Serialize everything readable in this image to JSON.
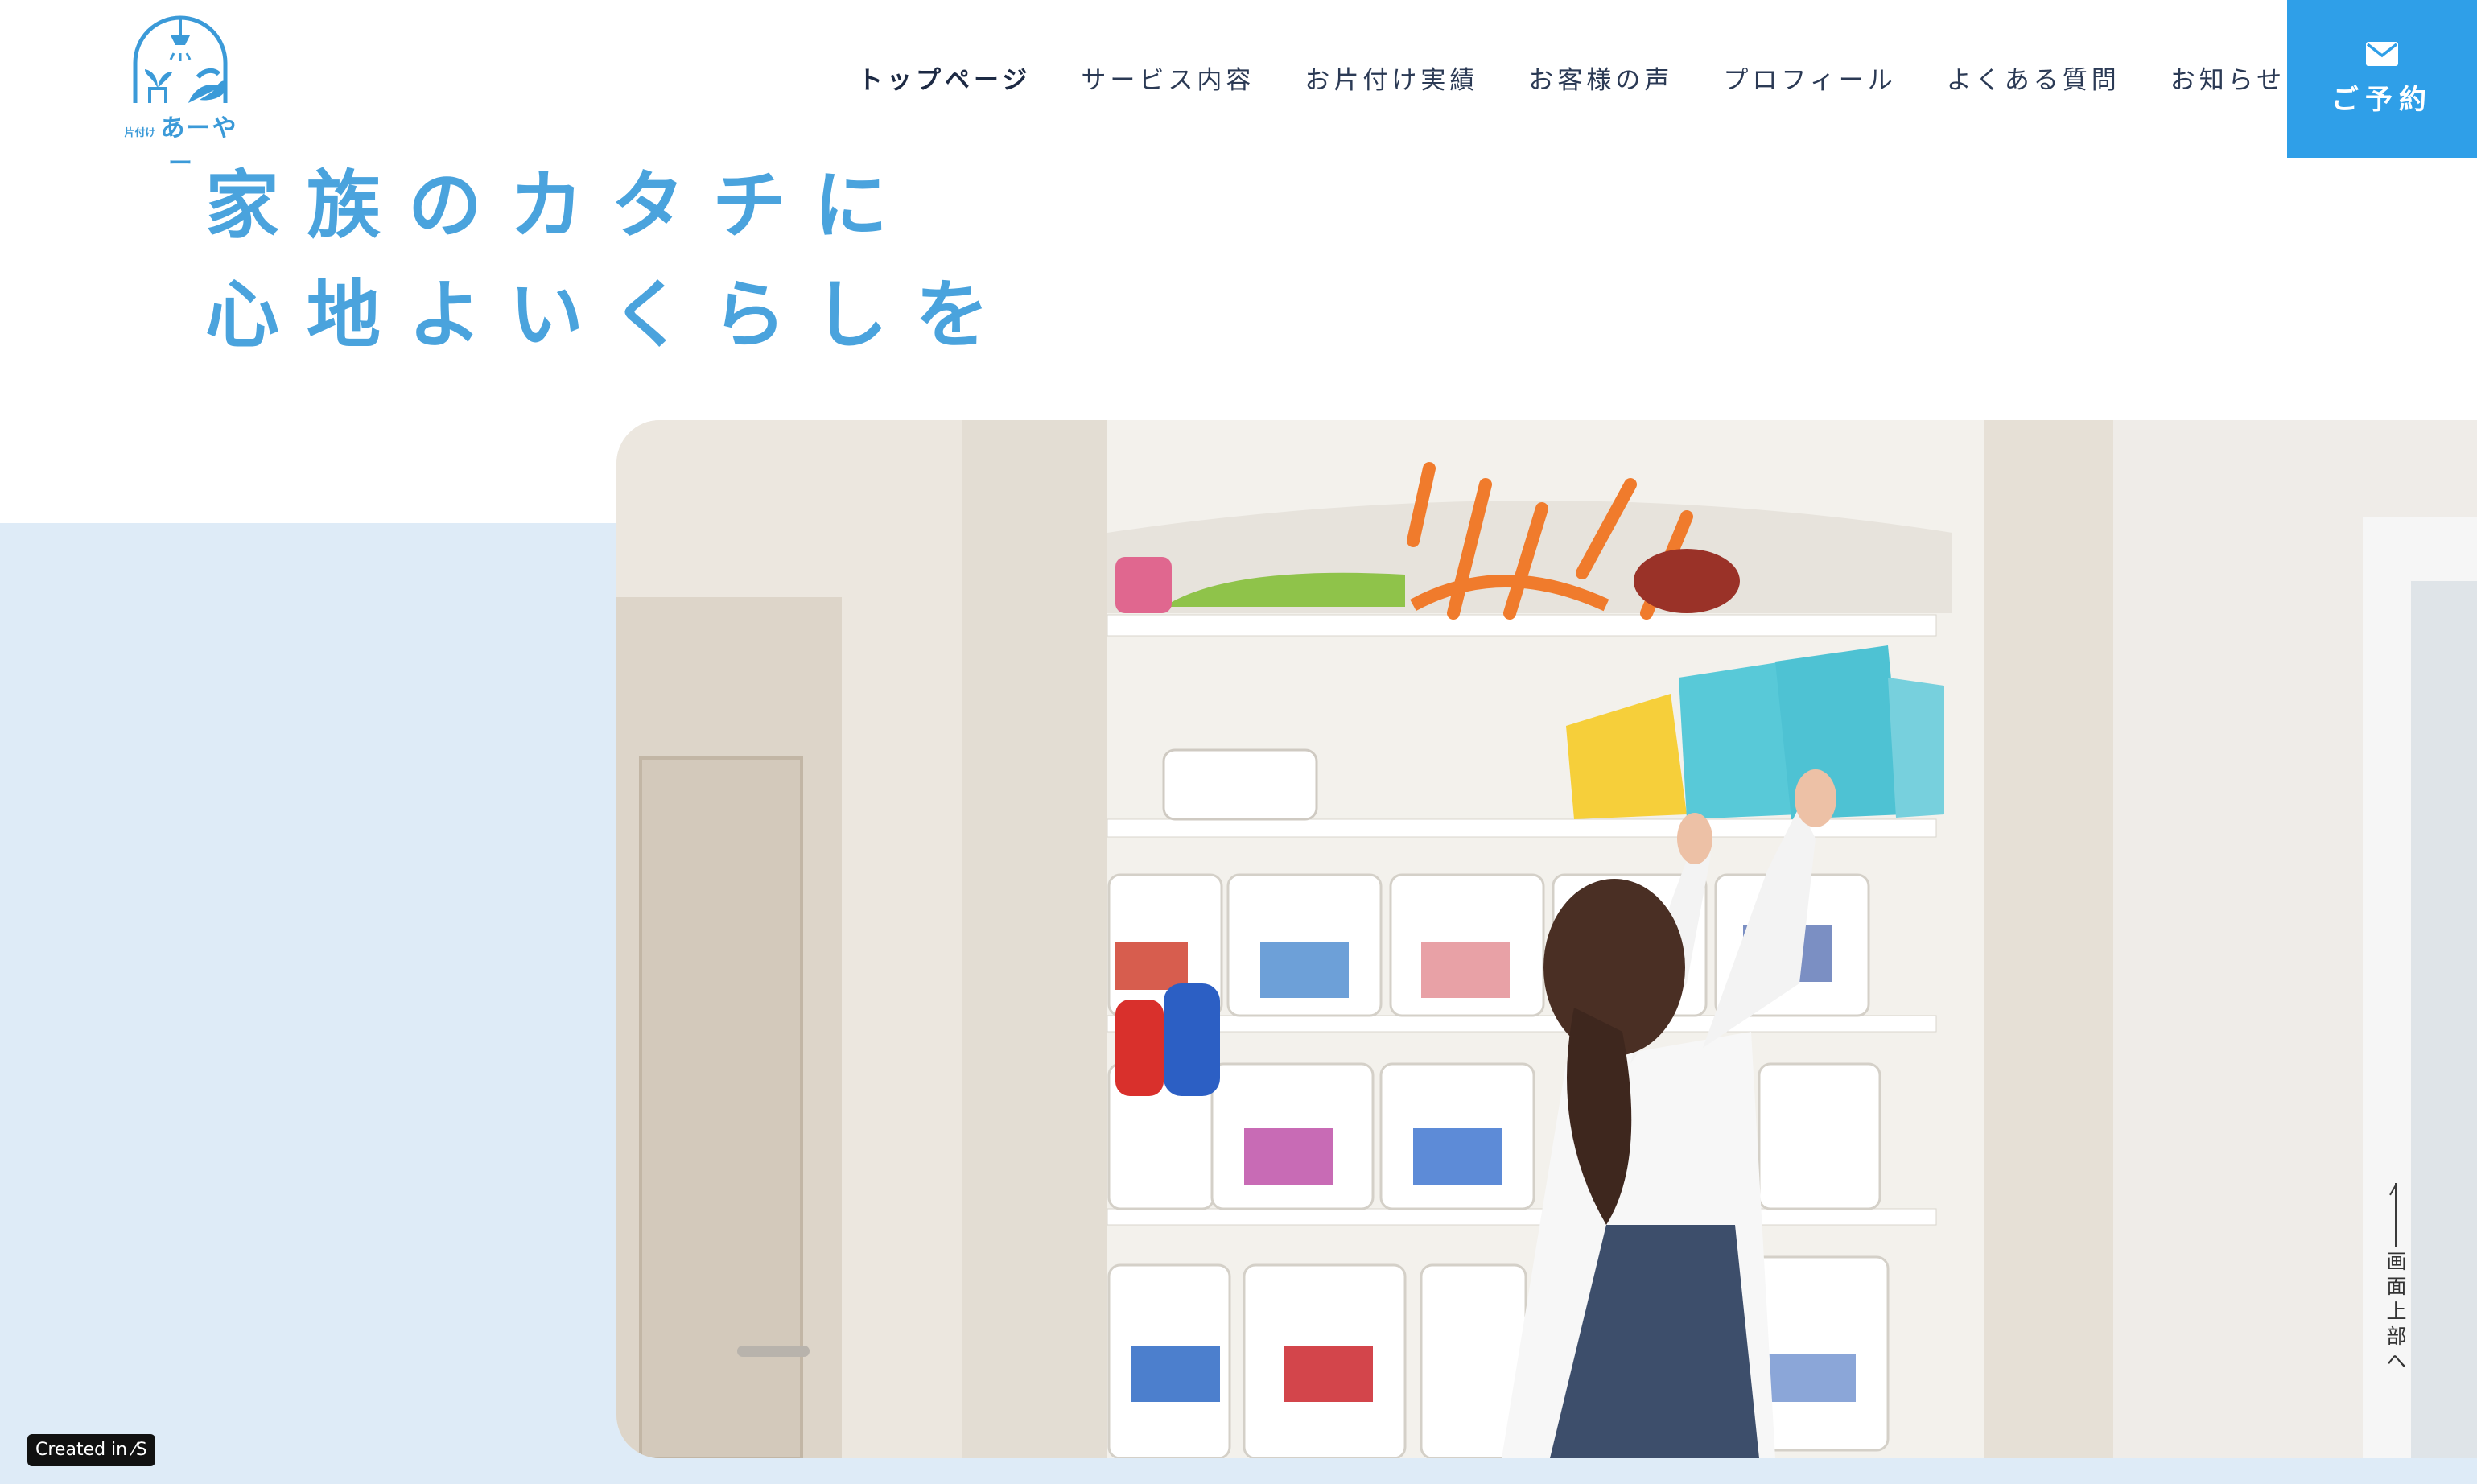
{
  "logo": {
    "small_text": "片付け",
    "name": "あーやー"
  },
  "nav": {
    "items": [
      {
        "label": "トップページ"
      },
      {
        "label": "サービス内容"
      },
      {
        "label": "お片付け実績"
      },
      {
        "label": "お客様の声"
      },
      {
        "label": "プロフィール"
      },
      {
        "label": "よくある質問"
      },
      {
        "label": "お知らせ"
      }
    ],
    "active_index": 0
  },
  "reserve": {
    "label": "ご予約",
    "icon": "mail-icon"
  },
  "hero": {
    "line1": "家族のカタチに",
    "line2": "心地よいくらしを"
  },
  "back_to_top": {
    "label": "画面上部へ"
  },
  "badge": {
    "label": "Created in ⁄S"
  },
  "colors": {
    "accent": "#2f9fe8",
    "headline": "#4aa3dd",
    "backdrop": "#deebf7",
    "nav_text": "#2b3a55"
  }
}
